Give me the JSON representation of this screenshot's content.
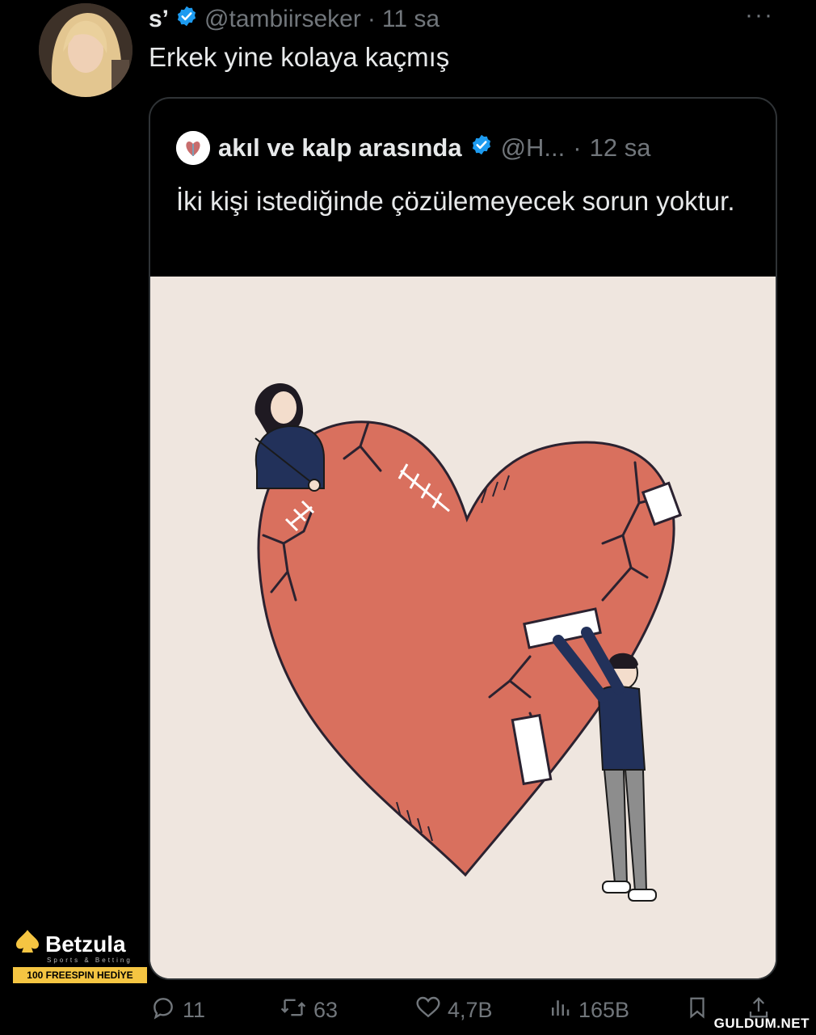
{
  "tweet": {
    "name": "s’",
    "handle": "@tambiirseker",
    "separator": "·",
    "time": "11 sa",
    "more": "···",
    "text": "Erkek yine kolaya kaçmış"
  },
  "quoted": {
    "name": "akıl ve kalp arasında",
    "handle": "@H...",
    "separator": "·",
    "time": "12 sa",
    "text": "İki kişi istediğinde çözülemeyecek sorun yoktur."
  },
  "actions": {
    "replies": "11",
    "retweets": "63",
    "likes": "4,7B",
    "views": "165B"
  },
  "badge": {
    "brand": "Betzula",
    "subtitle": "Sports & Betting",
    "promo": "100 FREESPIN HEDİYE"
  },
  "watermark": "GULDUM.NET",
  "colors": {
    "background": "#000000",
    "verified": "#1d9bf0",
    "heart": "#d9705e",
    "illustration_bg": "#efe6df"
  },
  "icons": [
    "reply-icon",
    "retweet-icon",
    "like-icon",
    "views-icon",
    "bookmark-icon",
    "share-icon",
    "verified-icon"
  ]
}
